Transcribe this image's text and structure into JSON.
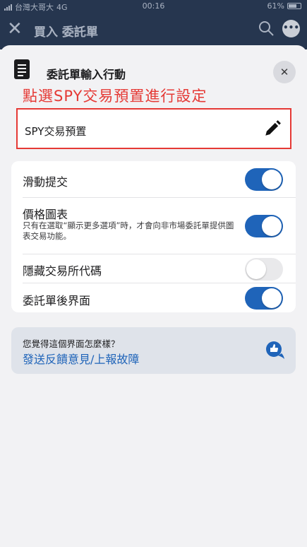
{
  "status_bar": {
    "carrier": "台灣大哥大",
    "network": "4G",
    "time": "00:16",
    "battery": "61%"
  },
  "nav": {
    "title": "買入 委託單"
  },
  "sheet": {
    "title": "委託單輸入行動",
    "annotation": "點選SPY交易預置進行設定",
    "preset_label": "SPY交易預置"
  },
  "settings": {
    "swipe_submit": {
      "label": "滑動提交",
      "on": true
    },
    "price_chart": {
      "label": "價格圖表",
      "sub": "只有在選取“顯示更多選項”時，才會向非市場委託單提供圖表交易功能。",
      "on": true
    },
    "hide_exchange": {
      "label": "隱藏交易所代碼",
      "on": false
    },
    "post_order": {
      "label": "委託單後界面",
      "on": true
    }
  },
  "feedback": {
    "question": "您覺得這個界面怎麼樣？",
    "link": "發送反饋意見/上報故障"
  },
  "colors": {
    "accent": "#1f64b9",
    "annotation": "#e53935",
    "header": "#26364f"
  }
}
